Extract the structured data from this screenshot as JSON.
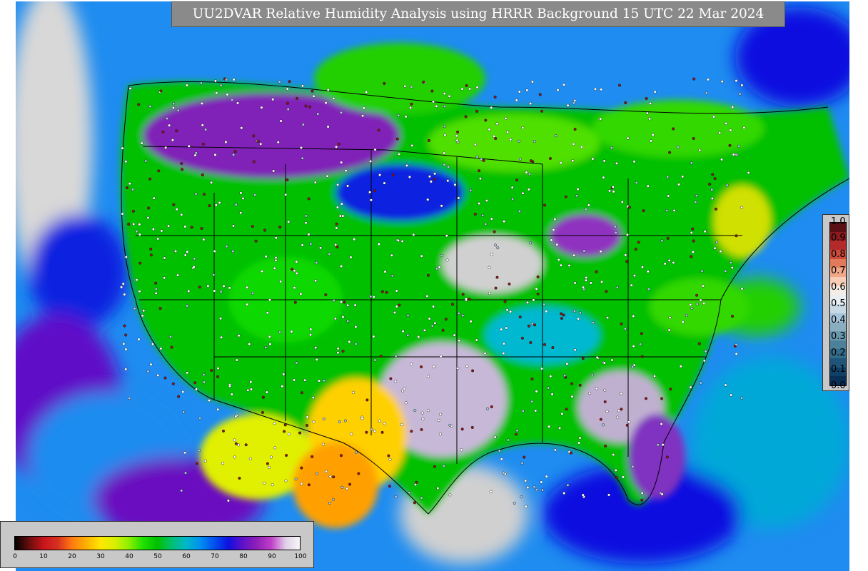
{
  "title": "UU2DVAR Relative Humidity Analysis using HRRR Background 15 UTC 22 Mar 2024",
  "icons": {
    "map": "rh-analysis-map",
    "stations": "observation-station-markers"
  },
  "colors": {
    "background_ocean": "#1e8cf0",
    "banner": "#8a8a8a",
    "legend_panel": "#c8c8c8",
    "boundary_lines": "#000000"
  },
  "legend_right": {
    "labels": [
      "1.0",
      "0.9",
      "0.8",
      "0.7",
      "0.6",
      "0.5",
      "0.4",
      "0.3",
      "0.2",
      "0.1",
      "0.0"
    ],
    "colors": [
      "#5a0f14",
      "#8b1a1f",
      "#b32a2a",
      "#cc4a3a",
      "#e07a5a",
      "#f0a888",
      "#f7cdb8",
      "#f5ece6",
      "#e9eef3",
      "#c8d9e6",
      "#a6c4d9",
      "#88aebf",
      "#6a98ad",
      "#4d8199",
      "#336b88",
      "#1f5579",
      "#0f4068",
      "#0a2f55"
    ]
  },
  "legend_bottom": {
    "ticks": [
      "0",
      "10",
      "20",
      "30",
      "40",
      "50",
      "60",
      "70",
      "80",
      "90",
      "100"
    ],
    "stops": [
      "#000000",
      "#6a0d0d",
      "#c8141c",
      "#d83020",
      "#ff7a10",
      "#ffb000",
      "#ffe600",
      "#d8f000",
      "#8cf000",
      "#20e000",
      "#00c000",
      "#00c070",
      "#00b8c8",
      "#0090f0",
      "#0050f0",
      "#1010e0",
      "#6010c8",
      "#9020b8",
      "#c040c8",
      "#e0d0e8",
      "#f8f8f8"
    ]
  }
}
